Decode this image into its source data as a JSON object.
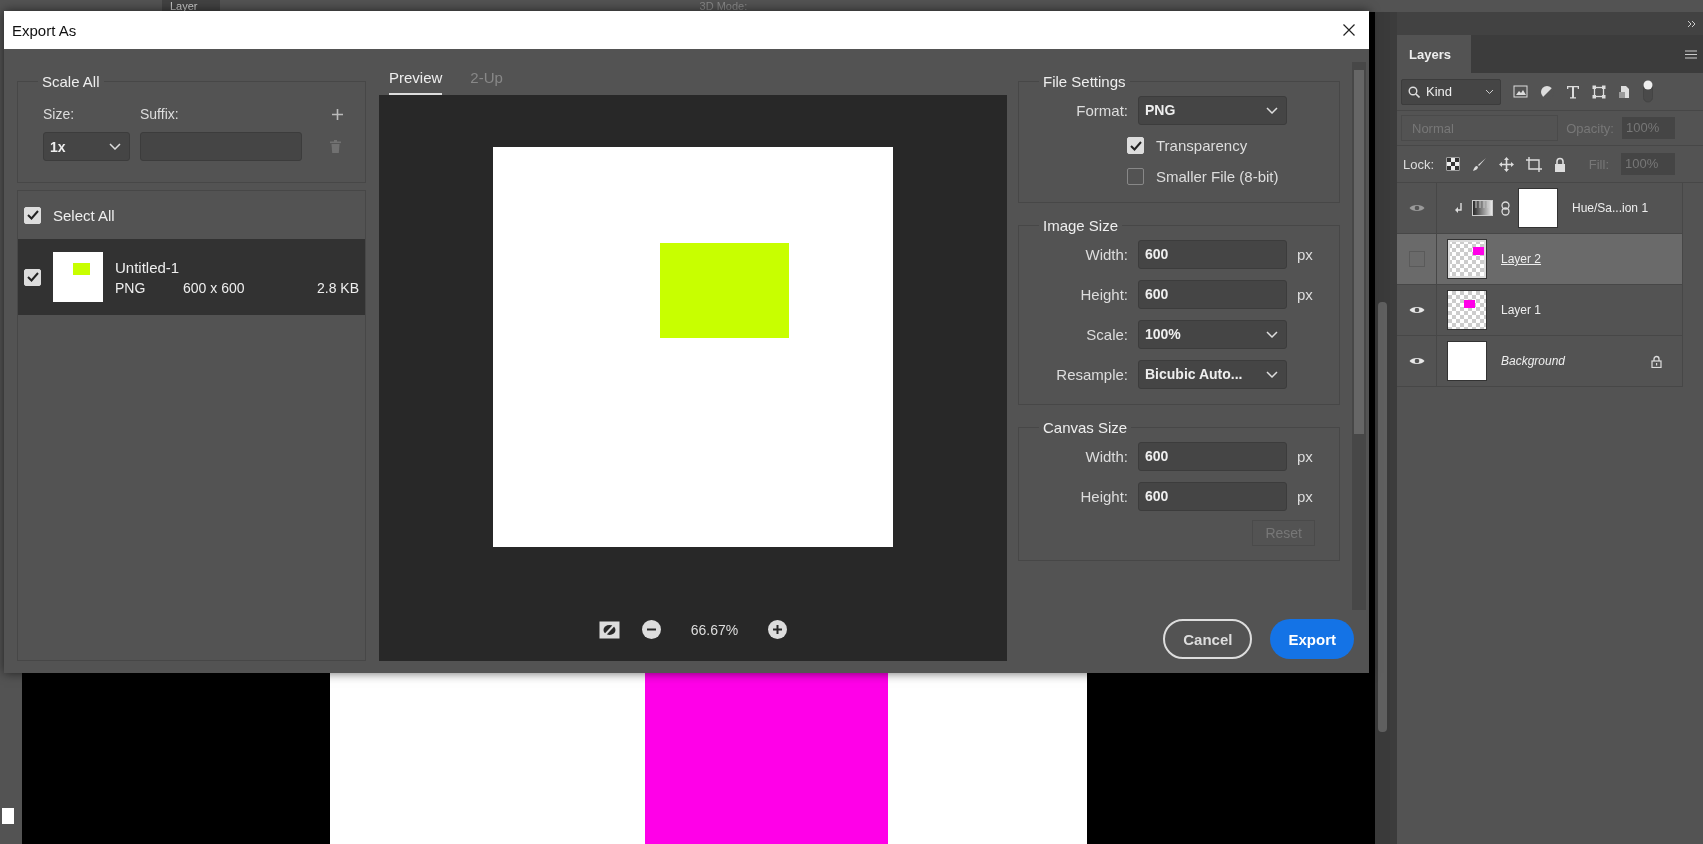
{
  "options_bar": {
    "layer_select": "Layer",
    "mode_label": "3D Mode:"
  },
  "dialog": {
    "title": "Export As",
    "scale_all": {
      "title": "Scale All",
      "size_label": "Size:",
      "suffix_label": "Suffix:",
      "size": "1x",
      "delete_disabled": true
    },
    "select_all": {
      "label": "Select All",
      "checked": true
    },
    "assets": [
      {
        "name": "Untitled-1",
        "format": "PNG",
        "dimensions": "600 x 600",
        "file_size": "2.8 KB",
        "checked": true,
        "selected": true
      }
    ],
    "preview_tabs": [
      {
        "label": "Preview",
        "selected": true
      },
      {
        "label": "2-Up",
        "selected": false
      }
    ],
    "zoom": "66.67%",
    "file_settings": {
      "title": "File Settings",
      "fields": [
        {
          "label": "Format:",
          "value": "PNG",
          "kind": "select"
        }
      ],
      "options": [
        {
          "label": "Transparency",
          "checked": true
        },
        {
          "label": "Smaller File (8-bit)",
          "checked": false
        }
      ]
    },
    "image_size": {
      "title": "Image Size",
      "fields": [
        {
          "label": "Width:",
          "value": "600",
          "unit": "px",
          "kind": "input"
        },
        {
          "label": "Height:",
          "value": "600",
          "unit": "px",
          "kind": "input"
        },
        {
          "label": "Scale:",
          "value": "100%",
          "kind": "select"
        },
        {
          "label": "Resample:",
          "value": "Bicubic Auto...",
          "kind": "select"
        }
      ]
    },
    "canvas_size": {
      "title": "Canvas Size",
      "fields": [
        {
          "label": "Width:",
          "value": "600",
          "unit": "px",
          "kind": "input"
        },
        {
          "label": "Height:",
          "value": "600",
          "unit": "px",
          "kind": "input"
        }
      ],
      "reset": {
        "label": "Reset",
        "disabled": true
      }
    },
    "buttons": [
      {
        "label": "Cancel",
        "kind": "secondary"
      },
      {
        "label": "Export",
        "kind": "primary"
      }
    ]
  },
  "layers_panel": {
    "title": "Layers",
    "filter": "Kind",
    "blend": {
      "mode": "Normal",
      "opacity_label": "Opacity:",
      "opacity": "100%",
      "disabled": true
    },
    "lock_label": "Lock:",
    "fill": {
      "label": "Fill:",
      "value": "100%",
      "disabled": true
    },
    "layers": [
      {
        "name": "Hue/Sa...ion 1",
        "kind": "adjustment",
        "visible": true,
        "selected": false,
        "locked": false
      },
      {
        "name": "Layer 2",
        "kind": "pixel",
        "visible": false,
        "selected": true,
        "locked": false
      },
      {
        "name": "Layer 1",
        "kind": "pixel",
        "visible": true,
        "selected": false,
        "locked": false
      },
      {
        "name": "Background",
        "kind": "background",
        "visible": true,
        "selected": false,
        "locked": true
      }
    ]
  }
}
